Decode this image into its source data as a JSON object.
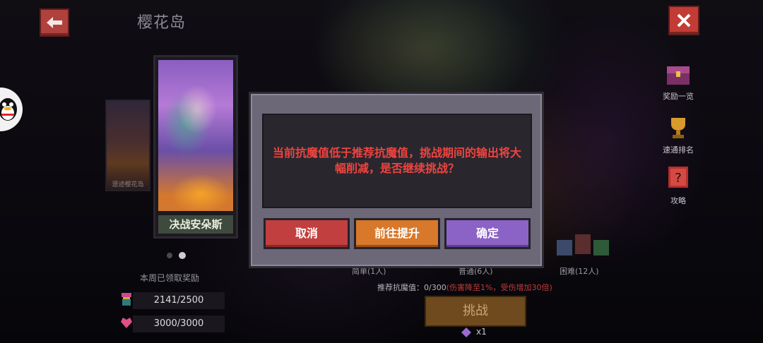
{
  "header": {
    "title": "樱花岛"
  },
  "cards": {
    "small_label": "遗迹樱花岛",
    "main_title": "决战安朵斯"
  },
  "rewards": {
    "weekly_label": "本周已领取奖励",
    "row1": "2141/2500",
    "row2": "3000/3000"
  },
  "side_menu": {
    "reward_list": "奖励一览",
    "speed_rank": "速通排名",
    "guide": "攻略"
  },
  "difficulty": {
    "easy": "简单(1人)",
    "normal": "普通(6人)",
    "hard": "困难(12人)"
  },
  "recommend": {
    "label": "推荐抗魔值：",
    "value": "0/300",
    "warning": "(伤害降至1%，受伤增加30倍)"
  },
  "challenge": {
    "label": "挑战",
    "cost": "x1"
  },
  "modal": {
    "message": "当前抗魔值低于推荐抗魔值，挑战期间的输出将大幅削减，是否继续挑战？",
    "cancel": "取消",
    "goto": "前往提升",
    "confirm": "确定"
  },
  "colors": {
    "modal_text": "#f0443f",
    "cancel_btn": "#c23f3f",
    "goto_btn": "#d7782b",
    "confirm_btn": "#8b63c7"
  },
  "icons": {
    "back": "back-arrow-icon",
    "close": "close-icon",
    "qq": "qq-penguin-icon",
    "reward_list": "treasure-chest-icon",
    "speed_rank": "trophy-icon",
    "guide": "guide-book-icon",
    "ticket": "ticket-icon"
  },
  "carousel": {
    "pages": 2,
    "active": 2
  }
}
